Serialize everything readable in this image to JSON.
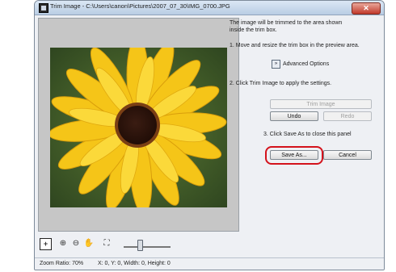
{
  "window": {
    "title": "Trim Image - C:\\Users\\canon\\Pictures\\2007_07_30\\IMG_0700.JPG",
    "close_label": "✕"
  },
  "panel": {
    "intro": "The image will be trimmed to the area shown inside the trim box.",
    "step1": "1.  Move and resize the trim box in the preview area.",
    "advanced_label": "Advanced Options",
    "advanced_icon": "»",
    "step2": "2. Click Trim Image to apply the settings.",
    "trim_button": "Trim Image",
    "undo_button": "Undo",
    "redo_button": "Redo",
    "step3": "3. Click Save As to close this panel",
    "save_as_button": "Save As...",
    "cancel_button": "Cancel"
  },
  "toolbar": {
    "fit_icon": "+",
    "zoom_in_icon": "⊕",
    "zoom_out_icon": "⊖",
    "hand_icon": "✋",
    "fullscreen_icon": "⛶",
    "zoom_level": 0.33
  },
  "status": {
    "zoom": "Zoom Ratio: 70%",
    "coords": "X: 0, Y: 0, Width: 0, Height: 0"
  }
}
